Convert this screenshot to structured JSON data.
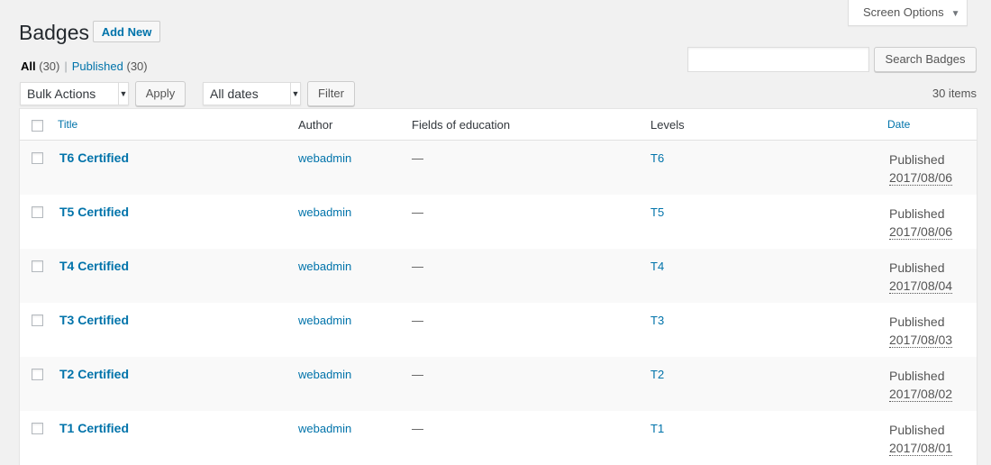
{
  "screen_options": {
    "label": "Screen Options"
  },
  "header": {
    "title": "Badges",
    "add_new": "Add New"
  },
  "views": {
    "all_label": "All",
    "all_count": "(30)",
    "published_label": "Published",
    "published_count": "(30)"
  },
  "search": {
    "placeholder": "",
    "button": "Search Badges"
  },
  "tablenav": {
    "bulk_actions": "Bulk Actions",
    "apply": "Apply",
    "dates": "All dates",
    "filter": "Filter",
    "items_count": "30 items"
  },
  "table": {
    "columns": {
      "title": "Title",
      "author": "Author",
      "fields": "Fields of education",
      "levels": "Levels",
      "date": "Date"
    },
    "rows": [
      {
        "title": "T6 Certified",
        "author": "webadmin",
        "fields": "—",
        "level": "T6",
        "status": "Published",
        "date": "2017/08/06"
      },
      {
        "title": "T5 Certified",
        "author": "webadmin",
        "fields": "—",
        "level": "T5",
        "status": "Published",
        "date": "2017/08/06"
      },
      {
        "title": "T4 Certified",
        "author": "webadmin",
        "fields": "—",
        "level": "T4",
        "status": "Published",
        "date": "2017/08/04"
      },
      {
        "title": "T3 Certified",
        "author": "webadmin",
        "fields": "—",
        "level": "T3",
        "status": "Published",
        "date": "2017/08/03"
      },
      {
        "title": "T2 Certified",
        "author": "webadmin",
        "fields": "—",
        "level": "T2",
        "status": "Published",
        "date": "2017/08/02"
      },
      {
        "title": "T1 Certified",
        "author": "webadmin",
        "fields": "—",
        "level": "T1",
        "status": "Published",
        "date": "2017/08/01"
      }
    ]
  }
}
